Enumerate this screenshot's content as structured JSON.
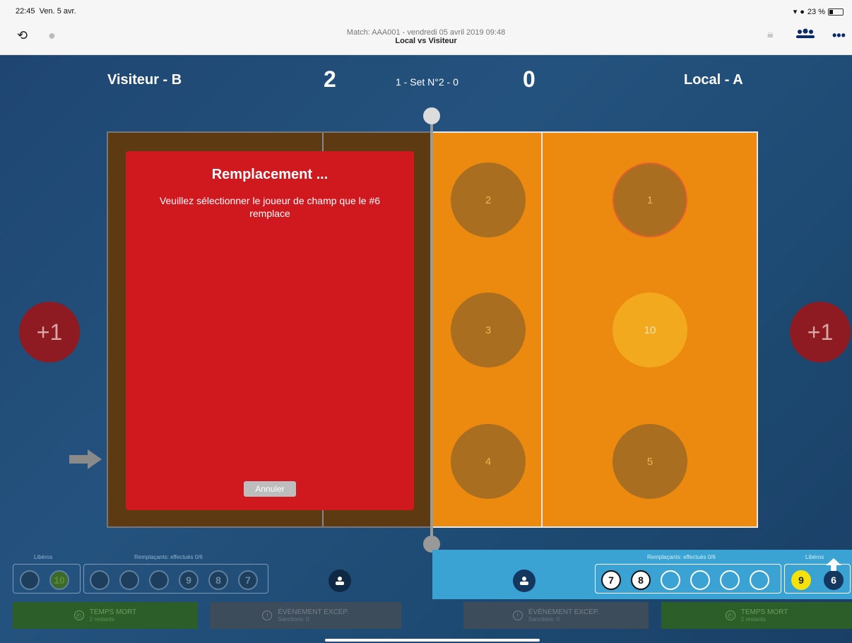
{
  "status": {
    "time": "22:45",
    "date": "Ven. 5 avr.",
    "battery": "23 %"
  },
  "nav": {
    "match_line": "Match: AAA001 - vendredi 05 avril 2019 09:48",
    "teams_line": "Local  vs  Visiteur"
  },
  "score": {
    "left_team": "Visiteur - B",
    "right_team": "Local - A",
    "left_score": "2",
    "right_score": "0",
    "set_label": "1 - Set N°2 - 0"
  },
  "court_right": {
    "players": [
      {
        "number": "2"
      },
      {
        "number": "1"
      },
      {
        "number": "3"
      },
      {
        "number": "10"
      },
      {
        "number": "4"
      },
      {
        "number": "5"
      }
    ]
  },
  "plus_one": "+1",
  "modal": {
    "title": "Remplacement ...",
    "message": "Veuillez sélectionner le joueur de champ que le #6 remplace",
    "cancel_label": "Annuler"
  },
  "left_panel": {
    "liberos_label": "Libéros",
    "subs_label": "Remplaçants: effectués 0/6",
    "liberos": [
      "",
      "10"
    ],
    "subs": [
      "",
      "",
      "",
      "9",
      "8",
      "7"
    ]
  },
  "right_panel": {
    "liberos_label": "Libéros",
    "subs_label": "Remplaçants: effectués 0/6",
    "subs": [
      "7",
      "8",
      "",
      "",
      "",
      ""
    ],
    "liberos": [
      "9",
      "6"
    ]
  },
  "buttons": {
    "timeout_label": "TEMPS MORT",
    "timeout_sub": "2 restants",
    "event_label": "ÉVÈNEMENT EXCEP.",
    "event_sub": "Sanctions: 0"
  },
  "colors": {
    "court_orange": "#ec8a10",
    "court_brown": "#5e3a12",
    "modal_red": "#d0181f",
    "panel_blue": "#3aa3d4"
  }
}
